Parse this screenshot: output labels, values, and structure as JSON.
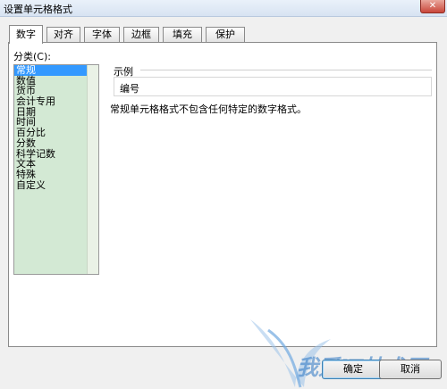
{
  "window": {
    "title": "设置单元格格式",
    "close_label": "✕"
  },
  "tabs": [
    {
      "label": "数字",
      "active": true
    },
    {
      "label": "对齐",
      "active": false
    },
    {
      "label": "字体",
      "active": false
    },
    {
      "label": "边框",
      "active": false
    },
    {
      "label": "填充",
      "active": false
    },
    {
      "label": "保护",
      "active": false
    }
  ],
  "category": {
    "label": "分类(C):",
    "selected": "常规",
    "items": [
      "常规",
      "数值",
      "货币",
      "会计专用",
      "日期",
      "时间",
      "百分比",
      "分数",
      "科学记数",
      "文本",
      "特殊",
      "自定义"
    ]
  },
  "sample": {
    "label": "示例",
    "value": "编号"
  },
  "description": "常规单元格格式不包含任何特定的数字格式。",
  "buttons": {
    "ok": "确定",
    "cancel": "取消"
  },
  "watermark": {
    "text": "我爱IT技术网",
    "colors": [
      "#6fa8e0",
      "#3b7fc8"
    ]
  }
}
